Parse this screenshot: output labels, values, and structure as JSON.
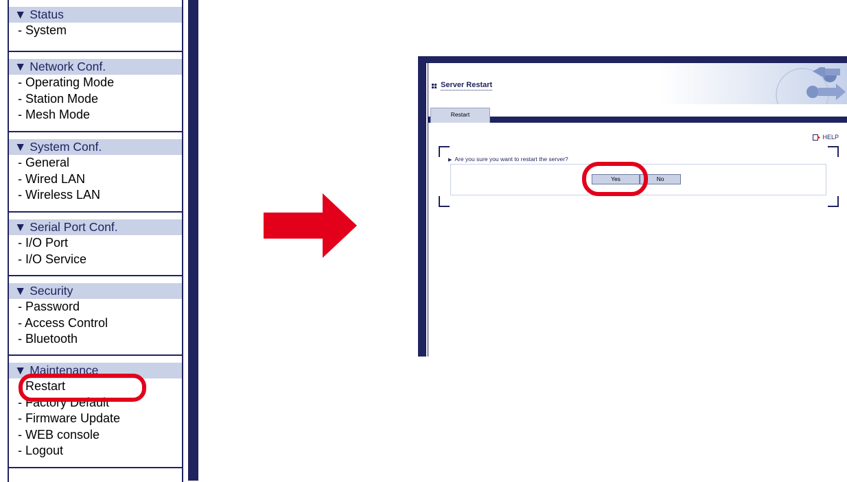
{
  "nav": {
    "sections": [
      {
        "title": "Status",
        "items": [
          "System"
        ]
      },
      {
        "title": "Network Conf.",
        "items": [
          "Operating Mode",
          "Station Mode",
          "Mesh Mode"
        ]
      },
      {
        "title": "System Conf.",
        "items": [
          "General",
          "Wired LAN",
          "Wireless LAN"
        ]
      },
      {
        "title": "Serial Port Conf.",
        "items": [
          "I/O Port",
          "I/O Service"
        ]
      },
      {
        "title": "Security",
        "items": [
          "Password",
          "Access Control",
          "Bluetooth"
        ]
      },
      {
        "title": "Maintenance",
        "items": [
          "Restart",
          "Factory Default",
          "Firmware Update",
          "WEB console",
          "Logout"
        ]
      }
    ],
    "section_marker": "▼",
    "item_prefix": "- "
  },
  "dialog": {
    "title": "Server Restart",
    "tab_label": "Restart",
    "help_label": "HELP",
    "question": "Are you sure you want to restart the server?",
    "yes_label": "Yes",
    "no_label": "No"
  },
  "colors": {
    "accent_navy": "#1f235e",
    "header_fill": "#c9d1e7",
    "highlight_red": "#e3001b"
  },
  "icons": [
    "section-collapse-icon",
    "title-bullet-icon",
    "help-icon",
    "question-arrow-icon",
    "right-arrow"
  ]
}
